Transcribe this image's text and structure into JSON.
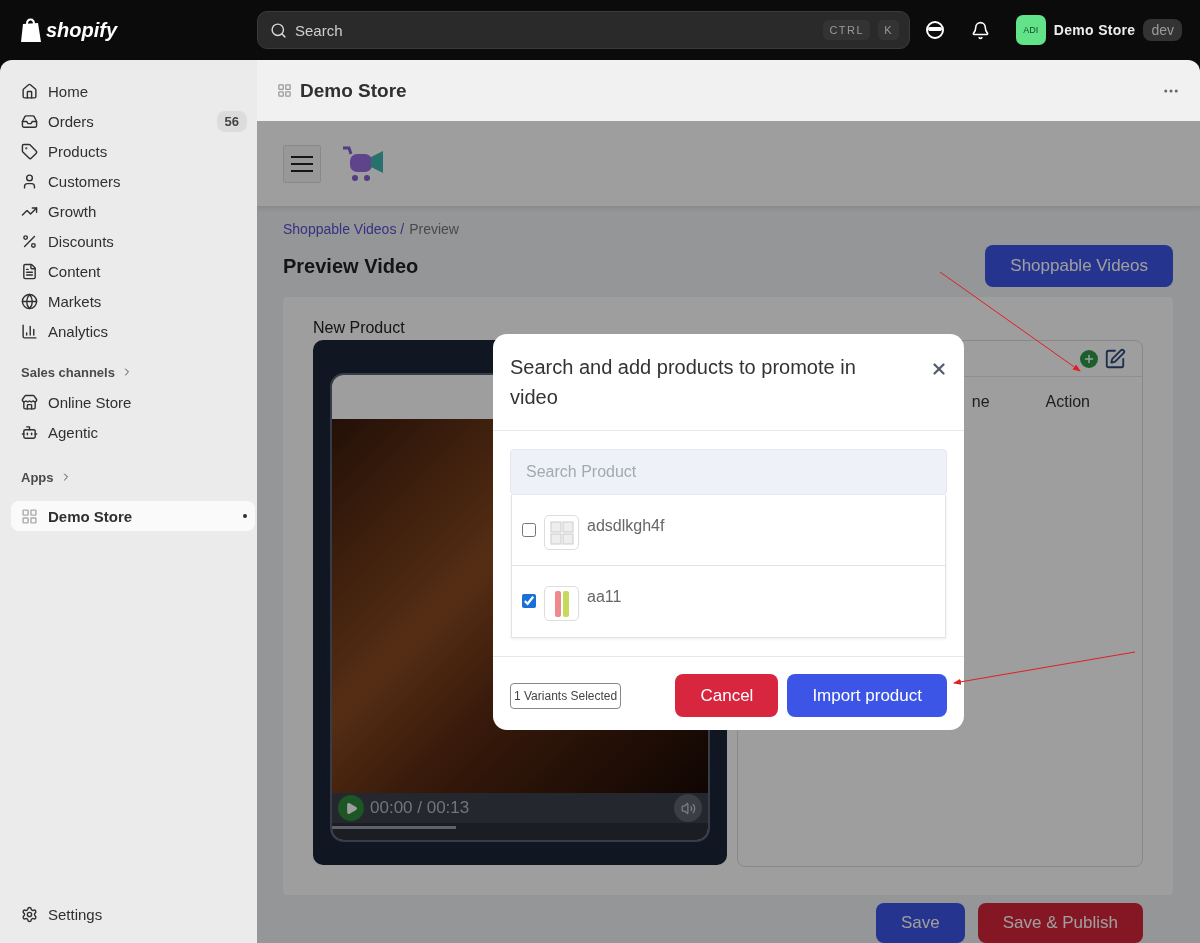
{
  "topbar": {
    "logo": "shopify",
    "search": {
      "placeholder": "Search",
      "keys": [
        "CTRL",
        "K"
      ]
    },
    "avatar": "ADI",
    "store": "Demo Store",
    "badge": "dev"
  },
  "sidebar": {
    "items": [
      {
        "label": "Home",
        "selected": false
      },
      {
        "label": "Orders",
        "selected": false,
        "count": "56"
      },
      {
        "label": "Products",
        "selected": false
      },
      {
        "label": "Customers",
        "selected": false
      },
      {
        "label": "Growth",
        "selected": false
      },
      {
        "label": "Discounts",
        "selected": false
      },
      {
        "label": "Content",
        "selected": false
      },
      {
        "label": "Markets",
        "selected": false
      },
      {
        "label": "Analytics",
        "selected": false
      }
    ],
    "sales_channels": {
      "title": "Sales channels",
      "items": [
        {
          "label": "Online Store",
          "selected": false
        },
        {
          "label": "Agentic",
          "selected": false
        }
      ]
    },
    "apps": {
      "title": "Apps",
      "items": [
        {
          "label": "Demo Store",
          "selected": true
        }
      ]
    },
    "settings": "Settings"
  },
  "page_header": {
    "title": "Demo Store"
  },
  "app": {
    "breadcrumb": {
      "link": "Shoppable Videos /",
      "current": "Preview"
    },
    "title": "Preview Video",
    "top_button": "Shoppable Videos",
    "video_label": "New Product",
    "video": {
      "time": "00:00 / 00:13",
      "level": 0.33
    },
    "table_columns": [
      "ne",
      "Action"
    ],
    "buttons": [
      {
        "label": "Save",
        "kind": "primary"
      },
      {
        "label": "Save & Publish",
        "kind": "danger"
      }
    ]
  },
  "modal": {
    "title": "Search and add products to promote in video",
    "search_placeholder": "Search Product",
    "products": [
      {
        "name": "adsdlkgh4f",
        "checked": false
      },
      {
        "name": "aa11",
        "checked": true
      }
    ],
    "selected_count": "1 Variants Selected",
    "buttons": [
      {
        "label": "Cancel",
        "kind": "danger"
      },
      {
        "label": "Import product",
        "kind": "primary"
      }
    ]
  }
}
